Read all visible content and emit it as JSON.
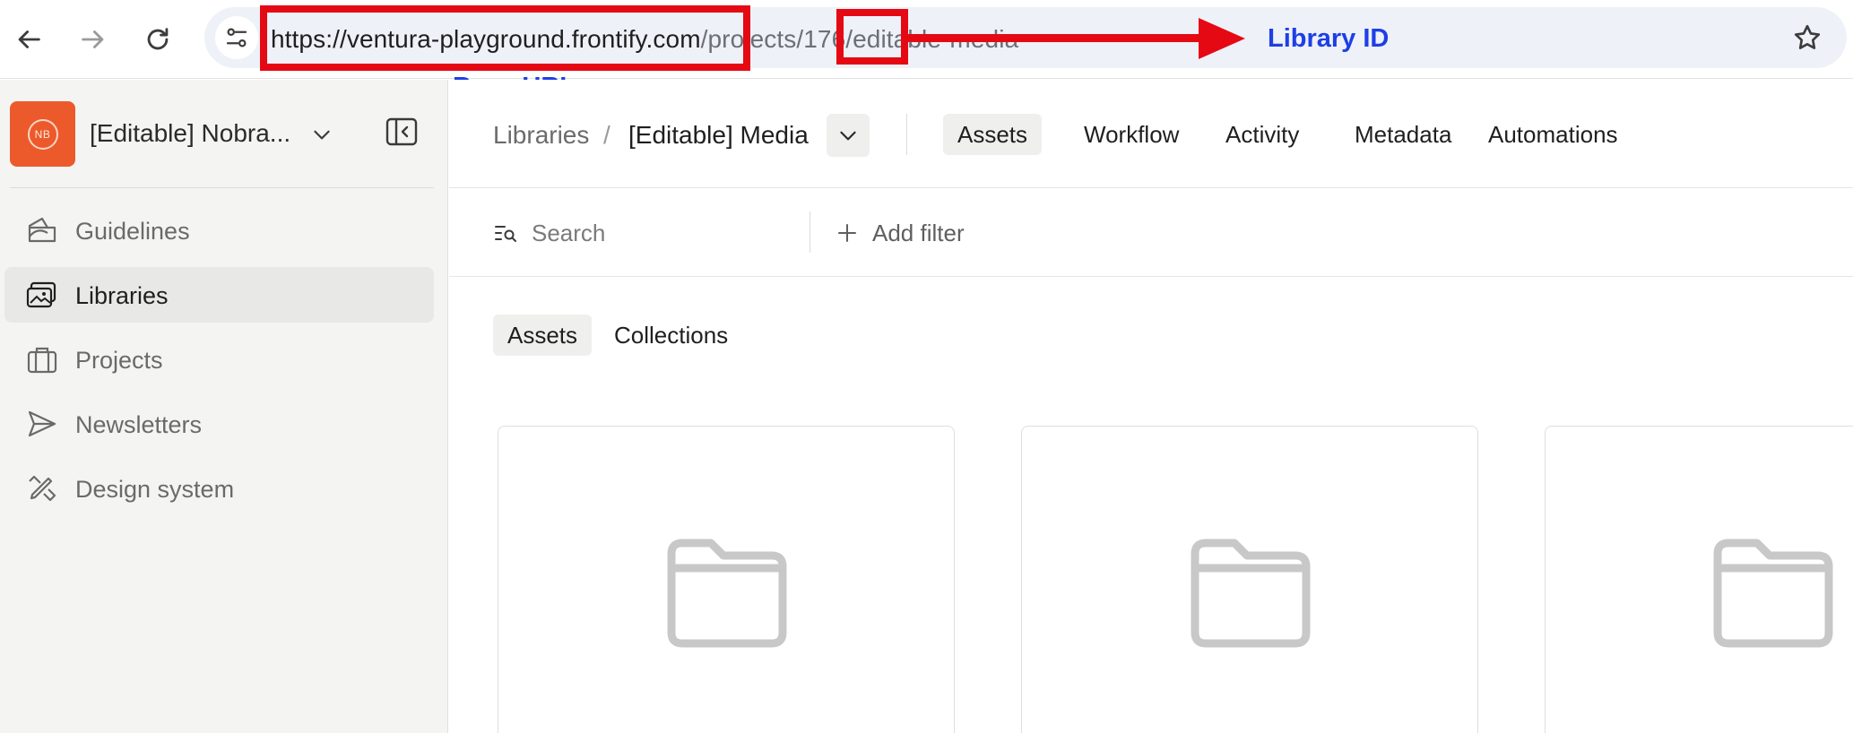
{
  "browser": {
    "url_base": "https://ventura-playground.frontify.com",
    "url_rest": "/projects/176/editable-media"
  },
  "annotations": {
    "library_id_label": "Library ID",
    "base_url_label": "Base URL",
    "box_color": "#e50914",
    "label_color": "#1d3fe6"
  },
  "sidebar": {
    "workspace_initials": "NB",
    "workspace_name": "[Editable] Nobra...",
    "items": [
      {
        "label": "Guidelines",
        "icon": "guidelines-icon"
      },
      {
        "label": "Libraries",
        "icon": "libraries-icon",
        "active": true
      },
      {
        "label": "Projects",
        "icon": "projects-icon"
      },
      {
        "label": "Newsletters",
        "icon": "newsletters-icon"
      },
      {
        "label": "Design system",
        "icon": "design-system-icon"
      }
    ]
  },
  "header": {
    "breadcrumb_root": "Libraries",
    "breadcrumb_separator": "/",
    "breadcrumb_current": "[Editable] Media",
    "tabs": [
      "Assets",
      "Workflow",
      "Activity",
      "Metadata",
      "Automations"
    ],
    "active_tab": "Assets"
  },
  "filters": {
    "search_placeholder": "Search",
    "add_filter_label": "Add filter"
  },
  "subtabs": [
    "Assets",
    "Collections"
  ],
  "colors": {
    "brand_accent": "#ec5a2c",
    "folder_icon": "#c8c8c8"
  }
}
